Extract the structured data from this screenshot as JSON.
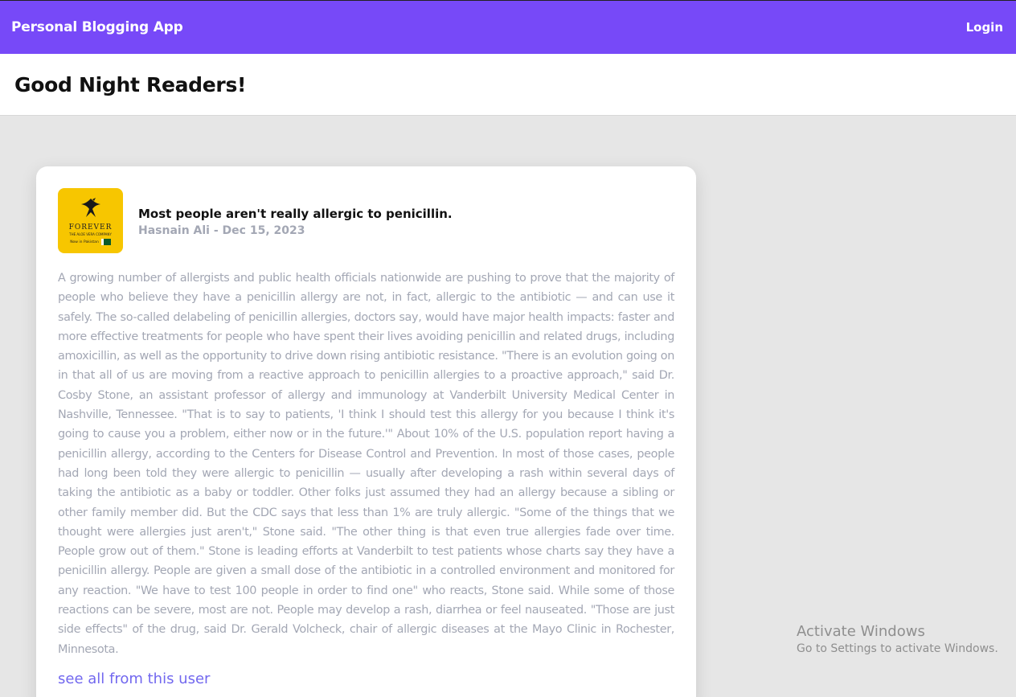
{
  "navbar": {
    "brand": "Personal Blogging App",
    "login_label": "Login"
  },
  "greeting": "Good Night Readers!",
  "post": {
    "avatar": {
      "brand_word": "FOREVER",
      "tagline": "THE ALOE VERA COMPANY",
      "now_in": "Now in Pakistan",
      "color": "#f7c600"
    },
    "title": "Most people aren't really allergic to penicillin.",
    "byline": "Hasnain Ali - Dec 15, 2023",
    "body": "A growing number of allergists and public health officials nationwide are pushing to prove that the majority of people who believe they have a penicillin allergy are not, in fact, allergic to the antibiotic — and can use it safely. The so-called delabeling of penicillin allergies, doctors say, would have major health impacts: faster and more effective treatments for people who have spent their lives avoiding penicillin and related drugs, including amoxicillin, as well as the opportunity to drive down rising antibiotic resistance. \"There is an evolution going on in that all of us are moving from a reactive approach to penicillin allergies to a proactive approach,\" said Dr. Cosby Stone, an assistant professor of allergy and immunology at Vanderbilt University Medical Center in Nashville, Tennessee. \"That is to say to patients, 'I think I should test this allergy for you because I think it's going to cause you a problem, either now or in the future.'\" About 10% of the U.S. population report having a penicillin allergy, according to the Centers for Disease Control and Prevention. In most of those cases, people had long been told they were allergic to penicillin — usually after developing a rash within several days of taking the antibiotic as a baby or toddler. Other folks just assumed they had an allergy because a sibling or other family member did. But the CDC says that less than 1% are truly allergic. \"Some of the things that we thought were allergies just aren't,\" Stone said. \"The other thing is that even true allergies fade over time. People grow out of them.\" Stone is leading efforts at Vanderbilt to test patients whose charts say they have a penicillin allergy. People are given a small dose of the antibiotic in a controlled environment and monitored for any reaction. \"We have to test 100 people in order to find one\" who reacts, Stone said. While some of those reactions can be severe, most are not. People may develop a rash, diarrhea or feel nauseated. \"Those are just side effects\" of the drug, said Dr. Gerald Volcheck, chair of allergic diseases at the Mayo Clinic in Rochester, Minnesota.",
    "see_all_label": "see all from this user"
  },
  "watermark": {
    "title": "Activate Windows",
    "subtitle": "Go to Settings to activate Windows."
  },
  "colors": {
    "navbar": "#7749f8",
    "background": "#e6e6e6",
    "body_text": "#a3a7b4",
    "link": "#7268ef"
  }
}
